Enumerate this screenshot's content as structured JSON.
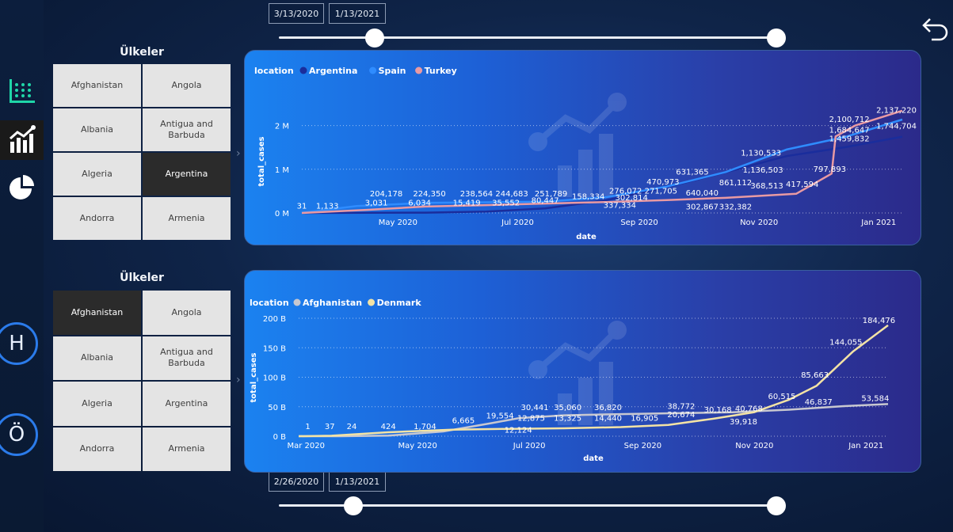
{
  "top_slider": {
    "start": "3/13/2020",
    "end": "1/13/2021"
  },
  "bottom_slider": {
    "start": "2/26/2020",
    "end": "1/13/2021"
  },
  "sidebar": {
    "circle_h": "H",
    "circle_o": "Ö"
  },
  "slicer_top": {
    "title": "Ülkeler",
    "items": [
      {
        "label": "Afghanistan",
        "selected": false
      },
      {
        "label": "Angola",
        "selected": false
      },
      {
        "label": "Albania",
        "selected": false
      },
      {
        "label": "Antigua and Barbuda",
        "selected": false
      },
      {
        "label": "Algeria",
        "selected": false
      },
      {
        "label": "Argentina",
        "selected": true
      },
      {
        "label": "Andorra",
        "selected": false
      },
      {
        "label": "Armenia",
        "selected": false
      }
    ]
  },
  "slicer_bottom": {
    "title": "Ülkeler",
    "items": [
      {
        "label": "Afghanistan",
        "selected": true
      },
      {
        "label": "Angola",
        "selected": false
      },
      {
        "label": "Albania",
        "selected": false
      },
      {
        "label": "Antigua and Barbuda",
        "selected": false
      },
      {
        "label": "Algeria",
        "selected": false
      },
      {
        "label": "Argentina",
        "selected": false
      },
      {
        "label": "Andorra",
        "selected": false
      },
      {
        "label": "Armenia",
        "selected": false
      }
    ]
  },
  "chart_data": [
    {
      "type": "line",
      "legend_title": "location",
      "xlabel": "date",
      "ylabel": "total_cases",
      "x_ticks": [
        "May 2020",
        "Jul 2020",
        "Sep 2020",
        "Nov 2020",
        "Jan 2021"
      ],
      "y_ticks": [
        "0 M",
        "1 M",
        "2 M"
      ],
      "ylim": [
        0,
        2300000
      ],
      "xlim": [
        "2020-03-13",
        "2021-01-13"
      ],
      "series": [
        {
          "name": "Argentina",
          "color": "#1a2d9c",
          "points": [
            [
              "2020-03-13",
              31
            ],
            [
              "2020-04-15",
              3000
            ],
            [
              "2020-05-15",
              8000
            ],
            [
              "2020-06-15",
              30000
            ],
            [
              "2020-07-15",
              105000
            ],
            [
              "2020-08-15",
              290000
            ],
            [
              "2020-09-15",
              590000
            ],
            [
              "2020-10-15",
              931000
            ],
            [
              "2020-11-15",
              1300000
            ],
            [
              "2020-12-15",
              1505000
            ],
            [
              "2021-01-13",
              1744704
            ]
          ]
        },
        {
          "name": "Spain",
          "color": "#2f8cff",
          "points": [
            [
              "2020-03-13",
              5000
            ],
            [
              "2020-04-10",
              157000
            ],
            [
              "2020-05-15",
              230000
            ],
            [
              "2020-06-15",
              244000
            ],
            [
              "2020-07-15",
              258000
            ],
            [
              "2020-08-15",
              360000
            ],
            [
              "2020-09-15",
              603000
            ],
            [
              "2020-10-15",
              937000
            ],
            [
              "2020-11-15",
              1450000
            ],
            [
              "2020-12-15",
              1740000
            ],
            [
              "2021-01-13",
              2137220
            ]
          ]
        },
        {
          "name": "Turkey",
          "color": "#e99aa3",
          "points": [
            [
              "2020-03-13",
              5
            ],
            [
              "2020-04-15",
              70000
            ],
            [
              "2020-05-15",
              146000
            ],
            [
              "2020-06-15",
              179000
            ],
            [
              "2020-07-15",
              215000
            ],
            [
              "2020-08-15",
              250000
            ],
            [
              "2020-09-15",
              295000
            ],
            [
              "2020-10-15",
              345000
            ],
            [
              "2020-11-20",
              440000
            ],
            [
              "2020-12-08",
              900000
            ],
            [
              "2020-12-10",
              1750000
            ],
            [
              "2020-12-20",
              2000000
            ],
            [
              "2021-01-13",
              2340000
            ]
          ]
        }
      ],
      "data_labels": [
        {
          "text": "31",
          "x": "2020-03-13",
          "y": 100000
        },
        {
          "text": "1,133",
          "x": "2020-03-26",
          "y": 100000
        },
        {
          "text": "204,178",
          "x": "2020-04-25",
          "y": 380000
        },
        {
          "text": "3,031",
          "x": "2020-04-20",
          "y": 170000
        },
        {
          "text": "224,350",
          "x": "2020-05-17",
          "y": 380000
        },
        {
          "text": "6,034",
          "x": "2020-05-12",
          "y": 170000
        },
        {
          "text": "238,564",
          "x": "2020-06-10",
          "y": 380000
        },
        {
          "text": "15,419",
          "x": "2020-06-05",
          "y": 170000
        },
        {
          "text": "244,683",
          "x": "2020-06-28",
          "y": 380000
        },
        {
          "text": "35,552",
          "x": "2020-06-25",
          "y": 170000
        },
        {
          "text": "251,789",
          "x": "2020-07-18",
          "y": 380000
        },
        {
          "text": "80,447",
          "x": "2020-07-15",
          "y": 230000
        },
        {
          "text": "158,334",
          "x": "2020-08-06",
          "y": 320000
        },
        {
          "text": "276,072",
          "x": "2020-08-25",
          "y": 440000
        },
        {
          "text": "302,814",
          "x": "2020-08-28",
          "y": 290000
        },
        {
          "text": "337,334",
          "x": "2020-08-22",
          "y": 120000
        },
        {
          "text": "470,973",
          "x": "2020-09-13",
          "y": 650000
        },
        {
          "text": "271,705",
          "x": "2020-09-12",
          "y": 440000
        },
        {
          "text": "631,365",
          "x": "2020-09-28",
          "y": 880000
        },
        {
          "text": "640,040",
          "x": "2020-10-03",
          "y": 400000
        },
        {
          "text": "302,867",
          "x": "2020-10-03",
          "y": 80000
        },
        {
          "text": "861,112",
          "x": "2020-10-20",
          "y": 630000
        },
        {
          "text": "332,382",
          "x": "2020-10-20",
          "y": 80000
        },
        {
          "text": "1,130,533",
          "x": "2020-11-02",
          "y": 1310000
        },
        {
          "text": "1,136,503",
          "x": "2020-11-03",
          "y": 920000
        },
        {
          "text": "368,513",
          "x": "2020-11-05",
          "y": 560000
        },
        {
          "text": "417,594",
          "x": "2020-11-23",
          "y": 600000
        },
        {
          "text": "797,893",
          "x": "2020-12-07",
          "y": 940000
        },
        {
          "text": "2,100,712",
          "x": "2020-12-17",
          "y": 2080000
        },
        {
          "text": "1,684,647",
          "x": "2020-12-17",
          "y": 1840000
        },
        {
          "text": "1,459,832",
          "x": "2020-12-17",
          "y": 1640000
        },
        {
          "text": "2,137,220",
          "x": "2021-01-10",
          "y": 2290000
        },
        {
          "text": "1,744,704",
          "x": "2021-01-10",
          "y": 1930000
        }
      ]
    },
    {
      "type": "line",
      "legend_title": "location",
      "xlabel": "date",
      "ylabel": "total_cases",
      "x_ticks": [
        "Mar 2020",
        "May 2020",
        "Jul 2020",
        "Sep 2020",
        "Nov 2020",
        "Jan 2021"
      ],
      "y_ticks": [
        "0 B",
        "50 B",
        "100 B",
        "150 B",
        "200 B"
      ],
      "ylim": [
        0,
        200000
      ],
      "xlim": [
        "2020-02-26",
        "2021-01-13"
      ],
      "series": [
        {
          "name": "Afghanistan",
          "color": "#c8c8d0",
          "points": [
            [
              "2020-02-26",
              1
            ],
            [
              "2020-03-20",
              37
            ],
            [
              "2020-04-15",
              1000
            ],
            [
              "2020-05-15",
              8000
            ],
            [
              "2020-06-10",
              22000
            ],
            [
              "2020-06-25",
              30441
            ],
            [
              "2020-07-20",
              35500
            ],
            [
              "2020-08-20",
              37500
            ],
            [
              "2020-09-20",
              39000
            ],
            [
              "2020-10-20",
              40500
            ],
            [
              "2020-11-20",
              45000
            ],
            [
              "2020-12-20",
              51000
            ],
            [
              "2021-01-13",
              54500
            ]
          ]
        },
        {
          "name": "Denmark",
          "color": "#f3e3a5",
          "points": [
            [
              "2020-02-26",
              1
            ],
            [
              "2020-03-15",
              800
            ],
            [
              "2020-04-15",
              6700
            ],
            [
              "2020-05-20",
              11000
            ],
            [
              "2020-06-20",
              12500
            ],
            [
              "2020-07-20",
              13400
            ],
            [
              "2020-08-20",
              15500
            ],
            [
              "2020-09-15",
              19000
            ],
            [
              "2020-10-10",
              30000
            ],
            [
              "2020-11-01",
              40768
            ],
            [
              "2020-11-20",
              62000
            ],
            [
              "2020-12-05",
              85663
            ],
            [
              "2020-12-25",
              144000
            ],
            [
              "2021-01-13",
              188000
            ]
          ]
        }
      ],
      "data_labels": [
        {
          "text": "1",
          "x": "2020-03-02",
          "y": 12000
        },
        {
          "text": "37",
          "x": "2020-03-14",
          "y": 12000
        },
        {
          "text": "24",
          "x": "2020-03-26",
          "y": 12000
        },
        {
          "text": "424",
          "x": "2020-04-15",
          "y": 12000
        },
        {
          "text": "1,704",
          "x": "2020-05-05",
          "y": 12000
        },
        {
          "text": "6,665",
          "x": "2020-05-26",
          "y": 22000
        },
        {
          "text": "19,554",
          "x": "2020-06-15",
          "y": 30000
        },
        {
          "text": "30,441",
          "x": "2020-07-04",
          "y": 44000
        },
        {
          "text": "12,875",
          "x": "2020-07-02",
          "y": 26000
        },
        {
          "text": "12,124",
          "x": "2020-06-25",
          "y": 6000
        },
        {
          "text": "35,060",
          "x": "2020-07-22",
          "y": 44000
        },
        {
          "text": "13,325",
          "x": "2020-07-22",
          "y": 26000
        },
        {
          "text": "36,820",
          "x": "2020-08-13",
          "y": 44000
        },
        {
          "text": "14,440",
          "x": "2020-08-13",
          "y": 26000
        },
        {
          "text": "16,905",
          "x": "2020-09-02",
          "y": 26000
        },
        {
          "text": "38,772",
          "x": "2020-09-22",
          "y": 46000
        },
        {
          "text": "20,674",
          "x": "2020-09-22",
          "y": 32000
        },
        {
          "text": "30,168",
          "x": "2020-10-12",
          "y": 40000
        },
        {
          "text": "40,768",
          "x": "2020-10-29",
          "y": 42000
        },
        {
          "text": "39,918",
          "x": "2020-10-26",
          "y": 20000
        },
        {
          "text": "60,515",
          "x": "2020-11-16",
          "y": 63000
        },
        {
          "text": "46,837",
          "x": "2020-12-06",
          "y": 54000
        },
        {
          "text": "85,663",
          "x": "2020-12-04",
          "y": 99000
        },
        {
          "text": "144,055",
          "x": "2020-12-21",
          "y": 155000
        },
        {
          "text": "53,584",
          "x": "2021-01-06",
          "y": 60000
        },
        {
          "text": "184,476",
          "x": "2021-01-08",
          "y": 192000
        }
      ]
    }
  ]
}
